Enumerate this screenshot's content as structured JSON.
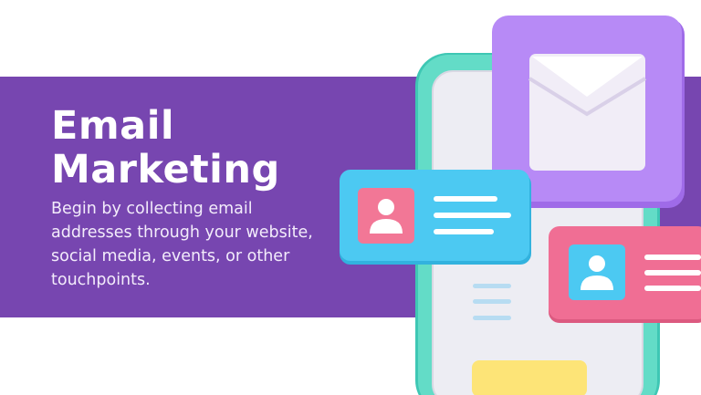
{
  "hero": {
    "title_line1": "Email",
    "title_line2": "Marketing",
    "description": "Begin by collecting email addresses through your website, social media, events, or other touchpoints."
  },
  "colors": {
    "band": "#7746b0",
    "phone_frame": "#63dcc7",
    "phone_screen": "#ededf3",
    "envelope_tile": "#b78af6",
    "contact_card_blue": "#4cc9f2",
    "contact_card_pink": "#f06e94",
    "button_yellow": "#fde477"
  },
  "icons": [
    "envelope-icon",
    "user-icon"
  ]
}
